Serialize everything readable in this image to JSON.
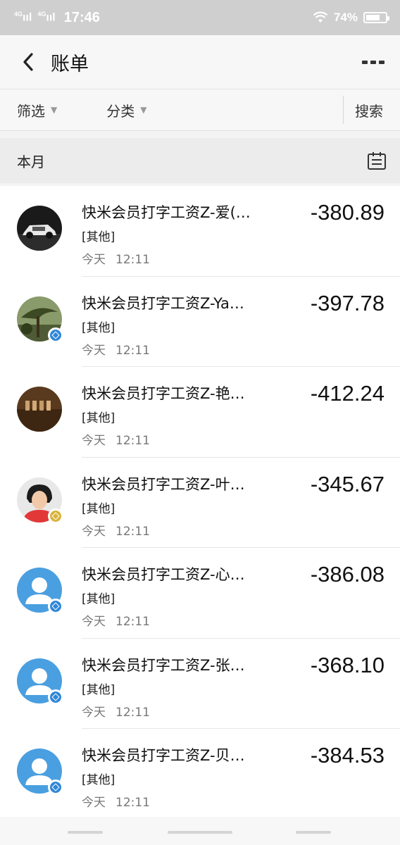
{
  "status_bar": {
    "signal_1": "4G",
    "signal_2": "4G",
    "time": "17:46",
    "battery_percent": "74%",
    "battery_level": 0.74
  },
  "nav": {
    "title": "账单"
  },
  "filters": {
    "filter_label": "筛选",
    "category_label": "分类",
    "search_label": "搜索"
  },
  "month": {
    "label": "本月"
  },
  "transactions": [
    {
      "title": "快米会员打字工资Z-爱(…",
      "category": "[其他]",
      "day": "今天",
      "time": "12:11",
      "amount": "-380.89",
      "avatar": "car-photo",
      "badge": "none"
    },
    {
      "title": "快米会员打字工资Z-Ya…",
      "category": "[其他]",
      "day": "今天",
      "time": "12:11",
      "amount": "-397.78",
      "avatar": "tree-photo",
      "badge": "blue"
    },
    {
      "title": "快米会员打字工资Z-艳…",
      "category": "[其他]",
      "day": "今天",
      "time": "12:11",
      "amount": "-412.24",
      "avatar": "shelf-photo",
      "badge": "none"
    },
    {
      "title": "快米会员打字工资Z-叶…",
      "category": "[其他]",
      "day": "今天",
      "time": "12:11",
      "amount": "-345.67",
      "avatar": "person-photo",
      "badge": "gold"
    },
    {
      "title": "快米会员打字工资Z-心…",
      "category": "[其他]",
      "day": "今天",
      "time": "12:11",
      "amount": "-386.08",
      "avatar": "default-user",
      "badge": "blue"
    },
    {
      "title": "快米会员打字工资Z-张…",
      "category": "[其他]",
      "day": "今天",
      "time": "12:11",
      "amount": "-368.10",
      "avatar": "default-user",
      "badge": "blue"
    },
    {
      "title": "快米会员打字工资Z-贝…",
      "category": "[其他]",
      "day": "今天",
      "time": "12:11",
      "amount": "-384.53",
      "avatar": "default-user",
      "badge": "blue"
    }
  ]
}
